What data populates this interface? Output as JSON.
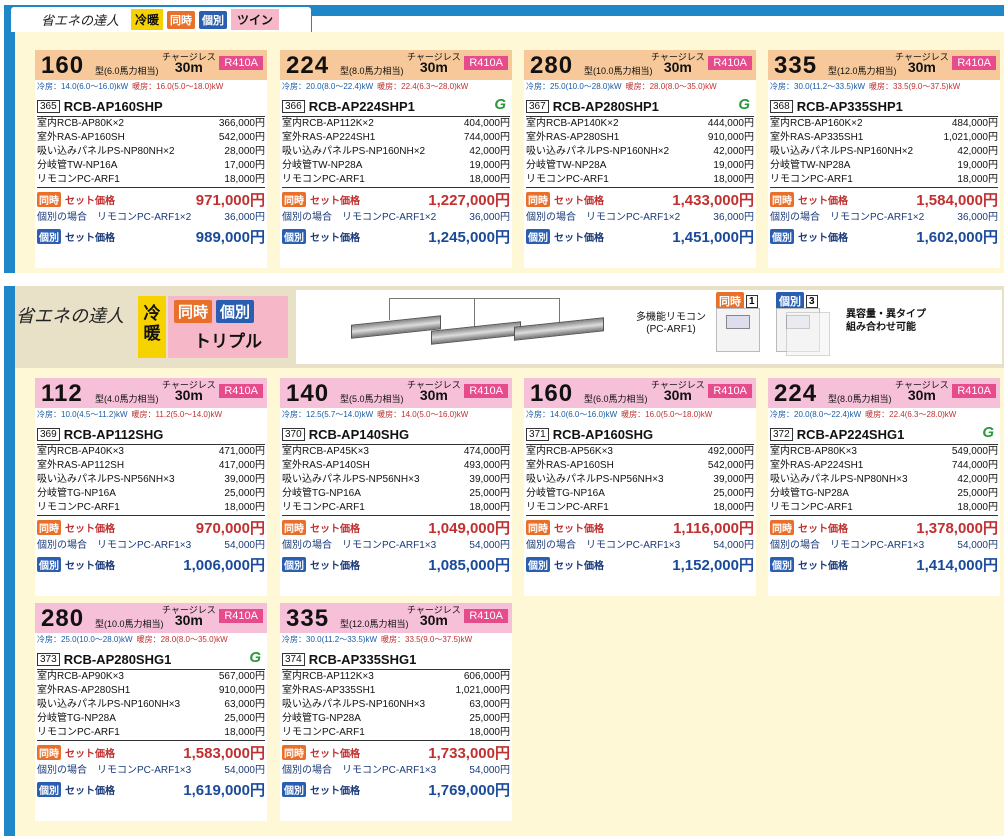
{
  "s1": {
    "brand": "省エネの達人",
    "cool": "冷暖",
    "sim": "同時",
    "ind": "個別",
    "type": "ツイン"
  },
  "s2": {
    "brand": "省エネの達人",
    "cool": "冷暖",
    "sim": "同時",
    "ind": "個別",
    "type": "トリプル",
    "remote_label": "多機能リモコン",
    "remote_model": "(PC-ARF1)",
    "sim_count": "1",
    "ind_count": "3",
    "combo1": "異容量・異タイプ",
    "combo2": "組み合わせ可能"
  },
  "colors": {
    "twin_header": "#f6c89a",
    "triple_header": "#f6c0d8"
  },
  "labels": {
    "chargeless": "チャージレス",
    "len": "30m",
    "ref": "R410A",
    "sim_label": "セット価格",
    "ind_pre": "個別の場合",
    "ind_label": "セット価格",
    "sim_badge": "同時",
    "ind_badge": "個別",
    "green": "G"
  },
  "cards": [
    {
      "cap": "160",
      "mt": "型(6.0馬力相当)",
      "cool": "冷房：14.0(6.0〜16.0)kW",
      "heat": "暖房：16.0(5.0〜18.0)kW",
      "no": "365",
      "model": "RCB-AP160SHP",
      "green": false,
      "parts": [
        [
          "室内RCB-AP80K×2",
          "366,000円"
        ],
        [
          "室外RAS-AP160SH",
          "542,000円"
        ],
        [
          "吸い込みパネルPS-NP80NH×2",
          "28,000円"
        ],
        [
          "分岐管TW-NP16A",
          "17,000円"
        ],
        [
          "リモコンPC-ARF1",
          "18,000円"
        ]
      ],
      "sim_price": "971,000円",
      "ind_remote": "リモコンPC-ARF1×2",
      "ind_remote_price": "36,000円",
      "ind_price": "989,000円"
    },
    {
      "cap": "224",
      "mt": "型(8.0馬力相当)",
      "cool": "冷房：20.0(8.0〜22.4)kW",
      "heat": "暖房：22.4(6.3〜28.0)kW",
      "no": "366",
      "model": "RCB-AP224SHP1",
      "green": true,
      "parts": [
        [
          "室内RCB-AP112K×2",
          "404,000円"
        ],
        [
          "室外RAS-AP224SH1",
          "744,000円"
        ],
        [
          "吸い込みパネルPS-NP160NH×2",
          "42,000円"
        ],
        [
          "分岐管TW-NP28A",
          "19,000円"
        ],
        [
          "リモコンPC-ARF1",
          "18,000円"
        ]
      ],
      "sim_price": "1,227,000円",
      "ind_remote": "リモコンPC-ARF1×2",
      "ind_remote_price": "36,000円",
      "ind_price": "1,245,000円"
    },
    {
      "cap": "280",
      "mt": "型(10.0馬力相当)",
      "cool": "冷房：25.0(10.0〜28.0)kW",
      "heat": "暖房：28.0(8.0〜35.0)kW",
      "no": "367",
      "model": "RCB-AP280SHP1",
      "green": true,
      "parts": [
        [
          "室内RCB-AP140K×2",
          "444,000円"
        ],
        [
          "室外RAS-AP280SH1",
          "910,000円"
        ],
        [
          "吸い込みパネルPS-NP160NH×2",
          "42,000円"
        ],
        [
          "分岐管TW-NP28A",
          "19,000円"
        ],
        [
          "リモコンPC-ARF1",
          "18,000円"
        ]
      ],
      "sim_price": "1,433,000円",
      "ind_remote": "リモコンPC-ARF1×2",
      "ind_remote_price": "36,000円",
      "ind_price": "1,451,000円"
    },
    {
      "cap": "335",
      "mt": "型(12.0馬力相当)",
      "cool": "冷房：30.0(11.2〜33.5)kW",
      "heat": "暖房：33.5(9.0〜37.5)kW",
      "no": "368",
      "model": "RCB-AP335SHP1",
      "green": false,
      "parts": [
        [
          "室内RCB-AP160K×2",
          "484,000円"
        ],
        [
          "室外RAS-AP335SH1",
          "1,021,000円"
        ],
        [
          "吸い込みパネルPS-NP160NH×2",
          "42,000円"
        ],
        [
          "分岐管TW-NP28A",
          "19,000円"
        ],
        [
          "リモコンPC-ARF1",
          "18,000円"
        ]
      ],
      "sim_price": "1,584,000円",
      "ind_remote": "リモコンPC-ARF1×2",
      "ind_remote_price": "36,000円",
      "ind_price": "1,602,000円"
    },
    {
      "cap": "112",
      "mt": "型(4.0馬力相当)",
      "cool": "冷房：10.0(4.5〜11.2)kW",
      "heat": "暖房：11.2(5.0〜14.0)kW",
      "no": "369",
      "model": "RCB-AP112SHG",
      "green": false,
      "parts": [
        [
          "室内RCB-AP40K×3",
          "471,000円"
        ],
        [
          "室外RAS-AP112SH",
          "417,000円"
        ],
        [
          "吸い込みパネルPS-NP56NH×3",
          "39,000円"
        ],
        [
          "分岐管TG-NP16A",
          "25,000円"
        ],
        [
          "リモコンPC-ARF1",
          "18,000円"
        ]
      ],
      "sim_price": "970,000円",
      "ind_remote": "リモコンPC-ARF1×3",
      "ind_remote_price": "54,000円",
      "ind_price": "1,006,000円"
    },
    {
      "cap": "140",
      "mt": "型(5.0馬力相当)",
      "cool": "冷房：12.5(5.7〜14.0)kW",
      "heat": "暖房：14.0(5.0〜16.0)kW",
      "no": "370",
      "model": "RCB-AP140SHG",
      "green": false,
      "parts": [
        [
          "室内RCB-AP45K×3",
          "474,000円"
        ],
        [
          "室外RAS-AP140SH",
          "493,000円"
        ],
        [
          "吸い込みパネルPS-NP56NH×3",
          "39,000円"
        ],
        [
          "分岐管TG-NP16A",
          "25,000円"
        ],
        [
          "リモコンPC-ARF1",
          "18,000円"
        ]
      ],
      "sim_price": "1,049,000円",
      "ind_remote": "リモコンPC-ARF1×3",
      "ind_remote_price": "54,000円",
      "ind_price": "1,085,000円"
    },
    {
      "cap": "160",
      "mt": "型(6.0馬力相当)",
      "cool": "冷房：14.0(6.0〜16.0)kW",
      "heat": "暖房：16.0(5.0〜18.0)kW",
      "no": "371",
      "model": "RCB-AP160SHG",
      "green": false,
      "parts": [
        [
          "室内RCB-AP56K×3",
          "492,000円"
        ],
        [
          "室外RAS-AP160SH",
          "542,000円"
        ],
        [
          "吸い込みパネルPS-NP56NH×3",
          "39,000円"
        ],
        [
          "分岐管TG-NP16A",
          "25,000円"
        ],
        [
          "リモコンPC-ARF1",
          "18,000円"
        ]
      ],
      "sim_price": "1,116,000円",
      "ind_remote": "リモコンPC-ARF1×3",
      "ind_remote_price": "54,000円",
      "ind_price": "1,152,000円"
    },
    {
      "cap": "224",
      "mt": "型(8.0馬力相当)",
      "cool": "冷房：20.0(8.0〜22.4)kW",
      "heat": "暖房：22.4(6.3〜28.0)kW",
      "no": "372",
      "model": "RCB-AP224SHG1",
      "green": true,
      "parts": [
        [
          "室内RCB-AP80K×3",
          "549,000円"
        ],
        [
          "室外RAS-AP224SH1",
          "744,000円"
        ],
        [
          "吸い込みパネルPS-NP80NH×3",
          "42,000円"
        ],
        [
          "分岐管TG-NP28A",
          "25,000円"
        ],
        [
          "リモコンPC-ARF1",
          "18,000円"
        ]
      ],
      "sim_price": "1,378,000円",
      "ind_remote": "リモコンPC-ARF1×3",
      "ind_remote_price": "54,000円",
      "ind_price": "1,414,000円"
    },
    {
      "cap": "280",
      "mt": "型(10.0馬力相当)",
      "cool": "冷房：25.0(10.0〜28.0)kW",
      "heat": "暖房：28.0(8.0〜35.0)kW",
      "no": "373",
      "model": "RCB-AP280SHG1",
      "green": true,
      "parts": [
        [
          "室内RCB-AP90K×3",
          "567,000円"
        ],
        [
          "室外RAS-AP280SH1",
          "910,000円"
        ],
        [
          "吸い込みパネルPS-NP160NH×3",
          "63,000円"
        ],
        [
          "分岐管TG-NP28A",
          "25,000円"
        ],
        [
          "リモコンPC-ARF1",
          "18,000円"
        ]
      ],
      "sim_price": "1,583,000円",
      "ind_remote": "リモコンPC-ARF1×3",
      "ind_remote_price": "54,000円",
      "ind_price": "1,619,000円"
    },
    {
      "cap": "335",
      "mt": "型(12.0馬力相当)",
      "cool": "冷房：30.0(11.2〜33.5)kW",
      "heat": "暖房：33.5(9.0〜37.5)kW",
      "no": "374",
      "model": "RCB-AP335SHG1",
      "green": false,
      "parts": [
        [
          "室内RCB-AP112K×3",
          "606,000円"
        ],
        [
          "室外RAS-AP335SH1",
          "1,021,000円"
        ],
        [
          "吸い込みパネルPS-NP160NH×3",
          "63,000円"
        ],
        [
          "分岐管TG-NP28A",
          "25,000円"
        ],
        [
          "リモコンPC-ARF1",
          "18,000円"
        ]
      ],
      "sim_price": "1,733,000円",
      "ind_remote": "リモコンPC-ARF1×3",
      "ind_remote_price": "54,000円",
      "ind_price": "1,769,000円"
    }
  ]
}
